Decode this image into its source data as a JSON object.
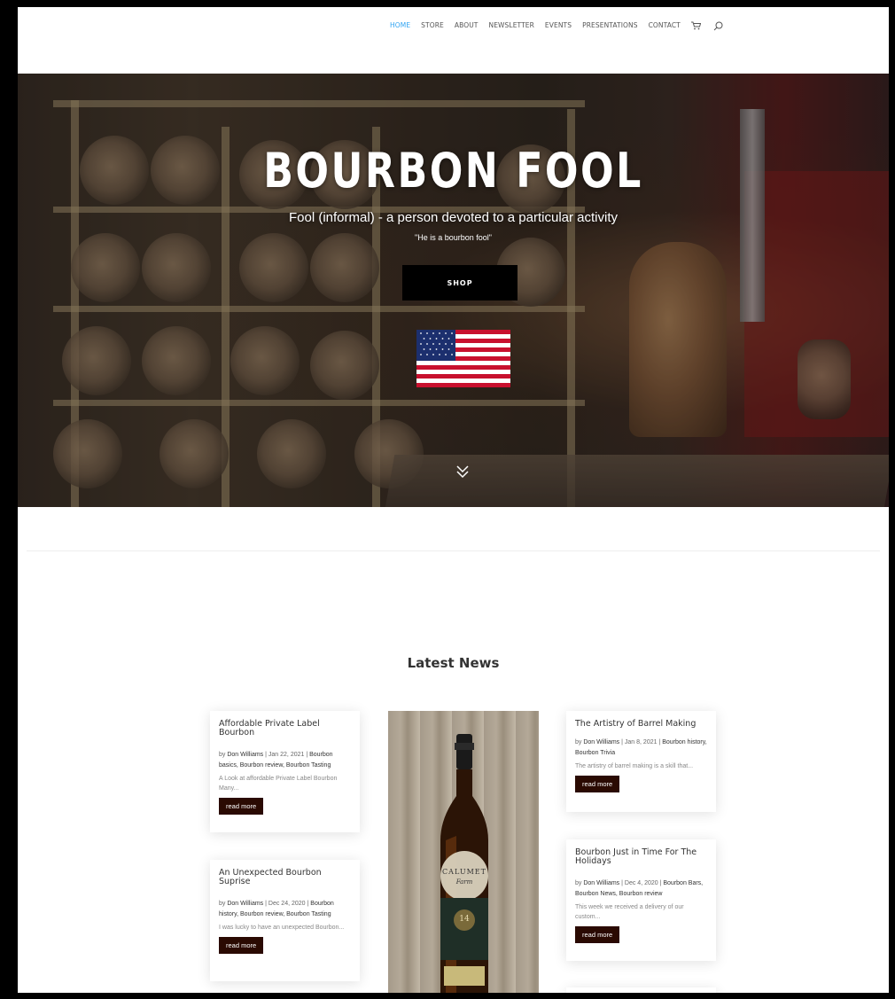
{
  "nav": {
    "items": [
      "HOME",
      "STORE",
      "ABOUT",
      "NEWSLETTER",
      "EVENTS",
      "PRESENTATIONS",
      "CONTACT"
    ],
    "active": "HOME",
    "cart_icon": "cart-icon",
    "search_icon": "search-icon"
  },
  "hero": {
    "title": "BOURBON FOOL",
    "subtitle": "Fool (informal) - a person devoted to a particular activity",
    "quote": "\"He is a bourbon fool\"",
    "shop_label": "SHOP",
    "flag_icon": "us-flag-icon",
    "scroll_icon": "double-chevron-down-icon"
  },
  "news": {
    "heading": "Latest News",
    "posts": [
      {
        "title": "Affordable Private Label Bourbon",
        "author": "Don Williams",
        "date": "Jan 22, 2021",
        "categories": "Bourbon basics, Bourbon review, Bourbon Tasting",
        "excerpt": "A Look at affordable Private Label Bourbon Many...",
        "read_more": "read more"
      },
      {
        "title": "An Unexpected Bourbon Suprise",
        "author": "Don Williams",
        "date": "Dec 24, 2020",
        "categories": "Bourbon history, Bourbon review, Bourbon Tasting",
        "excerpt": "I was lucky to have an unexpected Bourbon...",
        "read_more": "read more"
      },
      {
        "title": "The Artistry of Barrel Making",
        "author": "Don Williams",
        "date": "Jan 8, 2021",
        "categories": "Bourbon history, Bourbon Trivia",
        "excerpt": "The artistry of barrel making is a skill that...",
        "read_more": "read more"
      },
      {
        "title": "Bourbon Just in Time For The Holidays",
        "author": "Don Williams",
        "date": "Dec 4, 2020",
        "categories": "Bourbon Bars, Bourbon News, Bourbon review",
        "excerpt": "This week we received a delivery of our custom...",
        "read_more": "read more"
      }
    ],
    "bottle_label": "CALUMET",
    "bottle_sub": "Farm",
    "bottle_age": "14"
  },
  "colors": {
    "accent_active": "#2ea3f2",
    "button_dark": "#2a0a02",
    "hero_button": "#000000"
  }
}
